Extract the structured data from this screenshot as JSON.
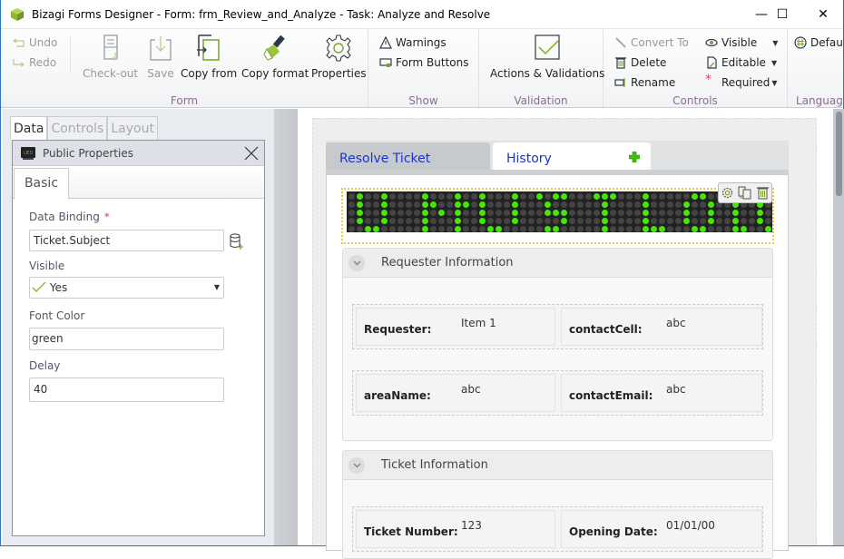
{
  "window": {
    "title": "Bizagi Forms Designer  - Form: frm_Review_and_Analyze - Task:  Analyze and Resolve",
    "controls": {
      "minimize": "—",
      "maximize": "☐",
      "close": "✕"
    }
  },
  "ribbon": {
    "form_group": {
      "label": "Form",
      "undo": "Undo",
      "redo": "Redo",
      "checkout": "Check-out",
      "save": "Save",
      "copy_from": "Copy from",
      "copy_format": "Copy format",
      "properties": "Properties"
    },
    "show_group": {
      "label": "Show",
      "warnings": "Warnings",
      "form_buttons": "Form Buttons"
    },
    "validation_group": {
      "label": "Validation",
      "actions": "Actions & Validations"
    },
    "controls_group": {
      "label": "Controls",
      "convert_to": "Convert To",
      "delete": "Delete",
      "rename": "Rename",
      "visible": "Visible",
      "editable": "Editable",
      "required": "Required"
    },
    "language_group": {
      "label": "Language",
      "default": "Default"
    }
  },
  "left_panel": {
    "tabs": [
      "Data",
      "Controls",
      "Layout"
    ],
    "active_tab": "Data",
    "properties": {
      "title": "Public Properties",
      "tab": "Basic",
      "fields": {
        "data_binding": {
          "label": "Data Binding",
          "required": "*",
          "value": "Ticket.Subject"
        },
        "visible": {
          "label": "Visible",
          "value": "Yes"
        },
        "font_color": {
          "label": "Font Color",
          "value": "green"
        },
        "delay": {
          "label": "Delay",
          "value": "40"
        }
      }
    }
  },
  "form": {
    "tabs": [
      {
        "label": "Resolve Ticket",
        "active": true
      },
      {
        "label": "History",
        "active": false
      },
      {
        "label": "+",
        "icon": "add-tab-icon"
      }
    ],
    "led_display": {
      "font_color": "#44e60a",
      "off_color": "#444444",
      "rows": [
        "0100100001000100100010010110001110001000001100011011001",
        "0100100001100110100010001000000100001000010010010010001",
        "0100100001010100100010001110000100001000010010010010001",
        "0100100001000100100010000010000100001000010010010010001",
        "0011000001000100011000001100000100001110001100011001110"
      ]
    },
    "sections": [
      {
        "title": "Requester Information",
        "rows": [
          [
            {
              "label": "Requester:",
              "value": "Item 1"
            },
            {
              "label": "contactCell:",
              "value": "abc"
            }
          ],
          [
            {
              "label": "areaName:",
              "value": "abc"
            },
            {
              "label": "contactEmail:",
              "value": "abc"
            }
          ]
        ]
      },
      {
        "title": "Ticket Information",
        "rows": [
          [
            {
              "label": "Ticket Number:",
              "value": "123"
            },
            {
              "label": "Opening Date:",
              "value": "01/01/00"
            }
          ]
        ]
      }
    ]
  }
}
